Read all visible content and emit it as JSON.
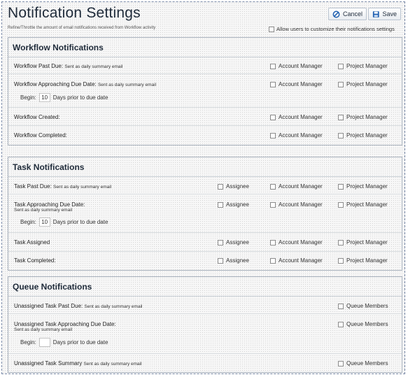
{
  "header": {
    "title": "Notification Settings",
    "subtitle": "Refine/Throttle the amount of email notifications received from Workflow activity",
    "cancel_label": "Cancel",
    "save_label": "Save",
    "allow_label": "Allow users to customize their notifications settings"
  },
  "workflow": {
    "title": "Workflow Notifications",
    "past_due": {
      "label": "Workflow Past Due:",
      "note": "Sent as daily summary email"
    },
    "approaching": {
      "label": "Workflow Approaching Due Date:",
      "note": "Sent as daily summary email"
    },
    "begin_label": "Begin:",
    "days_value": "10",
    "days_suffix": "Days prior to due date",
    "created": {
      "label": "Workflow Created:"
    },
    "completed": {
      "label": "Workflow Completed:"
    },
    "opt_account_manager": "Account Manager",
    "opt_project_manager": "Project Manager"
  },
  "task": {
    "title": "Task Notifications",
    "past_due": {
      "label": "Task Past Due:",
      "note": "Sent as daily summary email"
    },
    "approaching": {
      "label": "Task Approaching Due Date:",
      "note": "Sent as daily summary email"
    },
    "begin_label": "Begin:",
    "days_value": "10",
    "days_suffix": "Days prior to due date",
    "assigned": {
      "label": "Task Assigned"
    },
    "completed": {
      "label": "Task Completed:"
    },
    "opt_assignee": "Assignee",
    "opt_account_manager": "Account Manager",
    "opt_project_manager": "Project Manager"
  },
  "queue": {
    "title": "Queue Notifications",
    "past_due": {
      "label": "Unassigned Task Past Due:",
      "note": "Sent as daily summary email"
    },
    "approaching": {
      "label": "Unassigned Task Approaching Due Date:",
      "note": "Sent as daily summary email"
    },
    "begin_label": "Begin:",
    "days_value": "",
    "days_suffix": "Days prior to due date",
    "summary": {
      "label": "Unassigned Task Summary",
      "note": "Sent as daily summary email"
    },
    "opt_queue_members": "Queue Members"
  },
  "icons": {
    "cancel": "cancel-icon",
    "save": "save-icon"
  },
  "colors": {
    "accent": "#1f5fb0",
    "title": "#1f2b3a"
  }
}
